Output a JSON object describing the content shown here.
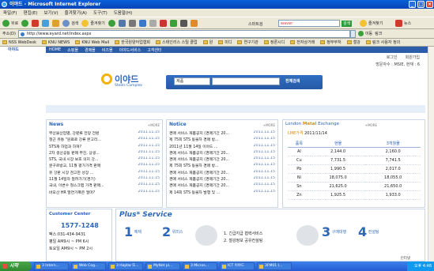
{
  "window": {
    "title": "이야드 - Microsoft Internet Explorer"
  },
  "menu": [
    "파일(F)",
    "편집(E)",
    "보기(V)",
    "즐겨찾기(A)",
    "도구(T)",
    "도움말(H)"
  ],
  "toolbar": {
    "back": "뒤로",
    "search": "검색",
    "favorites": "즐겨찾기",
    "search_engine": "스마트검",
    "search_value": "waver",
    "search_btn": "검색",
    "favorites_right": "즐겨찾기",
    "news": "뉴스"
  },
  "address": {
    "label": "주소(D)",
    "url": "http://www.eyard.net/index.aspx",
    "go": "이동",
    "links": "링크"
  },
  "links": [
    "NSS WebDesk",
    "KNU NEWS",
    "KNU Web Mail",
    "한국원양어업협회",
    "스테인리스 스틸 클럽",
    "원",
    "미디",
    "연구기관",
    "정론시디",
    "전자상거래",
    "정부부처",
    "철강",
    "링크 사용자 정의"
  ],
  "site": {
    "brand": "이야드",
    "nav": [
      "HOME",
      "쇼핑몰",
      "경매몰",
      "비즈몰",
      "이야드서비스",
      "고객센터"
    ],
    "util": [
      "로그인",
      "회원가입"
    ],
    "user_line": "방문자수 : MSIE, 현재 : 6",
    "logo_text": "이야드",
    "logo_sub": "Steels Complex",
    "search_select": "제품",
    "search_button": "전체검색"
  },
  "news": {
    "title": "News",
    "more": "+MORE",
    "items": [
      {
        "t": "부산물산업별, 강판류 전망 전환",
        "d": "2011.11.15"
      },
      {
        "t": "철근 유통 \"원료로 강류 본고리...",
        "d": "2011.11.15"
      },
      {
        "t": "STS재 하업과 하쳐?",
        "d": "2011.11.15"
      },
      {
        "t": "2차 생산공동 판매 부진, 상생...",
        "d": "2011.11.15"
      },
      {
        "t": "STS, 국내 시장 보호 의지 강...",
        "d": "2011.11.15"
      },
      {
        "t": "문구르방교, 11월 평가가격 판매",
        "d": "2011.11.15"
      },
      {
        "t": "유 강판 시장 견고한 성장 ...",
        "d": "2011.11.15"
      },
      {
        "t": "11월 14일자 알려가기(경기)",
        "d": "2011.11.15"
      },
      {
        "t": "국내, 이변수 철스크랩 가격 판매...",
        "d": "2011.11.15"
      },
      {
        "t": "바오산 HR 말연가폭은 얼마?",
        "d": "2011.11.15"
      }
    ]
  },
  "notice": {
    "title": "Notice",
    "more": "+MORE",
    "items": [
      {
        "t": "경매 서비스 재품공지 (경매기간 20...",
        "d": "2011.11.15"
      },
      {
        "t": "제 75회 STS 동물차 경매 방...",
        "d": "2011.11.15"
      },
      {
        "t": "2011년 11월 14일 이야드 ...",
        "d": "2011.11.15"
      },
      {
        "t": "경매 서비스 재품공지 (경매기간 20...",
        "d": "2011.11.15"
      },
      {
        "t": "경매 서비스 재품공지 (경매기간 20...",
        "d": "2011.11.15"
      },
      {
        "t": "제 75회 STS 동물차 경매 방...",
        "d": "2011.11.15"
      },
      {
        "t": "경매 서비스 재품공지 (경매기간 20...",
        "d": "2011.11.15"
      },
      {
        "t": "경매 서비스 재품공지 (경매기간 20...",
        "d": "2011.11.15"
      },
      {
        "t": "경매 서비스 재품공지 (경매기간 20...",
        "d": "2011.11.15"
      },
      {
        "t": "제 14회 STS 동물차 발행 및 ...",
        "d": "2011.11.15"
      }
    ]
  },
  "lme": {
    "title_parts": [
      "London",
      "Metal",
      "Exchange"
    ],
    "more": "+MORE",
    "date_label": "LME가격",
    "date": "2011/11/14",
    "headers": [
      "품목",
      "현물",
      "3개월물"
    ],
    "rows": [
      [
        "Al",
        "2,144.0",
        "2,160.0"
      ],
      [
        "Cu",
        "7,731.5",
        "7,741.5"
      ],
      [
        "Pb",
        "1,990.5",
        "2,017.0"
      ],
      [
        "Ni",
        "18,075.0",
        "18,055.0"
      ],
      [
        "Sn",
        "21,625.0",
        "21,650.0"
      ],
      [
        "Zn",
        "1,925.5",
        "1,933.0"
      ]
    ]
  },
  "customer": {
    "title": "Customer Center",
    "phone": "1577-1248",
    "fax": "팩스:031-434-9431",
    "hours1": "평일 AM9시 ~ PM 6시",
    "hours2": "토요일 AM9시 ~ PM 2시"
  },
  "service": {
    "title": "Plus* Service",
    "steps": [
      {
        "n": "1",
        "label": "예제"
      },
      {
        "n": "2",
        "label": "위미스"
      },
      {
        "n": "3",
        "label": "구매대행"
      },
      {
        "n": "4",
        "label": "컨설팅"
      }
    ],
    "desc1": "1. 긴급지급 협력서비스",
    "desc2": "2. 철강정보 공유컨설팅"
  },
  "status": {
    "zone": "인터넷"
  },
  "taskbar": {
    "start": "시작",
    "tasks": [
      "3 Intern...",
      "Web Cog...",
      "3 Haptw 또...",
      "MyNet pi...",
      "3 Micros...",
      "ICT 이야드",
      "3FM01 (..."
    ],
    "clock": "오후 4:48"
  }
}
